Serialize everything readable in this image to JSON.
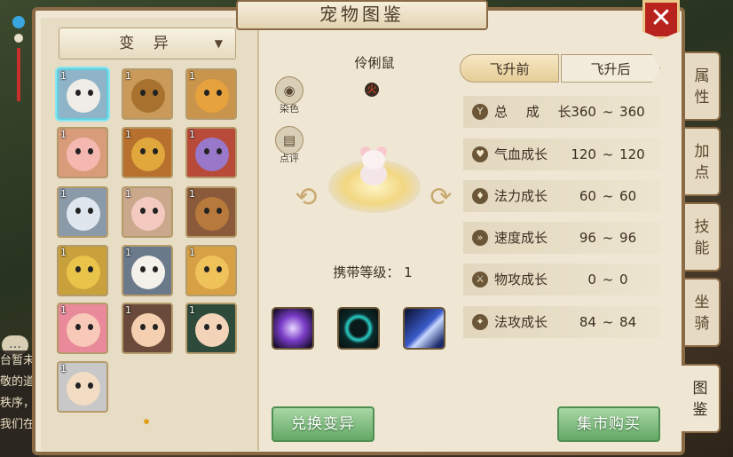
{
  "window": {
    "title": "宠物图鉴",
    "close_label": "✕"
  },
  "filter": {
    "selected": "变 异",
    "arrow": "▼"
  },
  "pets": [
    {
      "level": "1",
      "color": "#f0ece8",
      "bg": "#8fb4c8",
      "selected": true
    },
    {
      "level": "1",
      "color": "#a8722e",
      "bg": "#c99a5a",
      "selected": false
    },
    {
      "level": "1",
      "color": "#e6a23c",
      "bg": "#c9954c",
      "selected": false
    },
    {
      "level": "1",
      "color": "#f5b8b0",
      "bg": "#d89c7a",
      "selected": false
    },
    {
      "level": "1",
      "color": "#e0a83c",
      "bg": "#b8702e",
      "selected": false
    },
    {
      "level": "1",
      "color": "#9a78c9",
      "bg": "#b84a3a",
      "selected": false
    },
    {
      "level": "1",
      "color": "#dfe6ee",
      "bg": "#8a9aa8",
      "selected": false
    },
    {
      "level": "1",
      "color": "#f4c9c0",
      "bg": "#c9a88c",
      "selected": false
    },
    {
      "level": "1",
      "color": "#b87a3c",
      "bg": "#8a5a3a",
      "selected": false
    },
    {
      "level": "1",
      "color": "#e8c44a",
      "bg": "#c8a03c",
      "selected": false
    },
    {
      "level": "1",
      "color": "#f4f0ea",
      "bg": "#6a7a8a",
      "selected": false
    },
    {
      "level": "1",
      "color": "#f0c25a",
      "bg": "#d8a044",
      "selected": false
    },
    {
      "level": "1",
      "color": "#f8c8b8",
      "bg": "#e88a9a",
      "selected": false
    },
    {
      "level": "1",
      "color": "#f4d0b0",
      "bg": "#6a4a3a",
      "selected": false
    },
    {
      "level": "1",
      "color": "#f4d4b8",
      "bg": "#2e4a3a",
      "selected": false
    },
    {
      "level": "1",
      "color": "#f2dcc4",
      "bg": "#c8c8c8",
      "selected": false
    }
  ],
  "preview": {
    "pet_name": "伶俐鼠",
    "element_icon": "fire-icon",
    "element_glyph": "火",
    "dye_label": "染色",
    "dye_icon": "eye-icon",
    "review_label": "点评",
    "review_icon": "comment-icon",
    "carry_level": "携带等级： 1",
    "left_arrow": "⟲",
    "right_arrow": "⟳"
  },
  "skills": [
    {
      "name": "skill-swirl",
      "color": "#7a3cc8"
    },
    {
      "name": "skill-ring",
      "color": "#1a8a8a"
    },
    {
      "name": "skill-claw",
      "color": "#3a5ac8"
    }
  ],
  "tabs": {
    "before": "飞升前",
    "after": "飞升后"
  },
  "stats": [
    {
      "name": "总 成 长",
      "spaced": true,
      "value": "360 ~ 360",
      "icon": "Y"
    },
    {
      "name": "气血成长",
      "spaced": false,
      "value": "120 ~ 120",
      "icon": "♥"
    },
    {
      "name": "法力成长",
      "spaced": false,
      "value": "60 ~ 60",
      "icon": "♦"
    },
    {
      "name": "速度成长",
      "spaced": false,
      "value": "96 ~ 96",
      "icon": "»"
    },
    {
      "name": "物攻成长",
      "spaced": false,
      "value": "0 ~ 0",
      "icon": "⚔"
    },
    {
      "name": "法攻成长",
      "spaced": false,
      "value": "84 ~ 84",
      "icon": "✦"
    }
  ],
  "side_tabs": [
    {
      "label": "属\n性",
      "active": false
    },
    {
      "label": "加\n点",
      "active": false
    },
    {
      "label": "技\n能",
      "active": false
    },
    {
      "label": "坐\n骑",
      "active": false
    },
    {
      "label": "图\n鉴",
      "active": true
    }
  ],
  "buttons": {
    "exchange": "兑换变异",
    "market": "集市购买"
  },
  "chat": {
    "bubble": "…",
    "lines": [
      "台暂未",
      "敬的道",
      "秩序，",
      "我们在"
    ]
  },
  "colors": {
    "frame": "#8a6a45",
    "panel": "#efe7d3",
    "close": "#b8231e",
    "button_green": "#63a866",
    "selected_border": "#5fd0e0"
  }
}
